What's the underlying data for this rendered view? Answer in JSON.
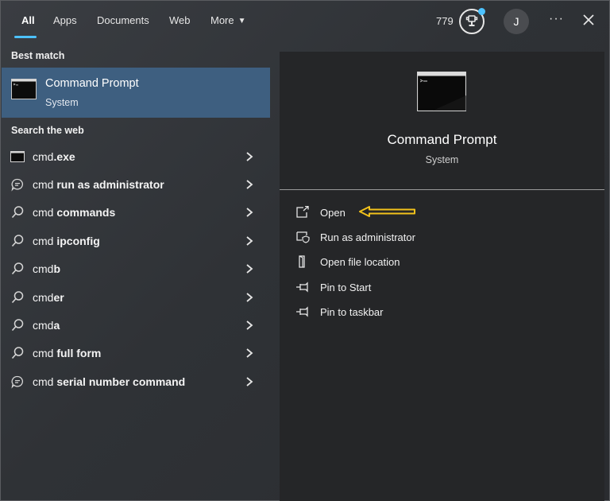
{
  "tabs": [
    {
      "label": "All"
    },
    {
      "label": "Apps"
    },
    {
      "label": "Documents"
    },
    {
      "label": "Web"
    },
    {
      "label": "More"
    }
  ],
  "header": {
    "points": "779",
    "avatar_initial": "J",
    "more_dots": "···"
  },
  "best_match": {
    "section_title": "Best match",
    "title": "Command Prompt",
    "subtitle": "System"
  },
  "web": {
    "section_title": "Search the web",
    "items": [
      {
        "prefix": "cmd",
        "bold": ".exe",
        "icon": "terminal-icon"
      },
      {
        "prefix": "cmd ",
        "bold": "run as administrator",
        "icon": "chat-search-icon"
      },
      {
        "prefix": "cmd ",
        "bold": "commands",
        "icon": "search-icon"
      },
      {
        "prefix": "cmd ",
        "bold": "ipconfig",
        "icon": "search-icon"
      },
      {
        "prefix": "cmd",
        "bold": "b",
        "icon": "search-icon"
      },
      {
        "prefix": "cmd",
        "bold": "er",
        "icon": "search-icon"
      },
      {
        "prefix": "cmd",
        "bold": "a",
        "icon": "search-icon"
      },
      {
        "prefix": "cmd ",
        "bold": "full form",
        "icon": "search-icon"
      },
      {
        "prefix": "cmd ",
        "bold": "serial number command",
        "icon": "chat-search-icon"
      }
    ]
  },
  "preview": {
    "title": "Command Prompt",
    "subtitle": "System",
    "actions": [
      {
        "label": "Open",
        "icon": "open-window-icon"
      },
      {
        "label": "Run as administrator",
        "icon": "shield-window-icon"
      },
      {
        "label": "Open file location",
        "icon": "folder-icon"
      },
      {
        "label": "Pin to Start",
        "icon": "pin-icon"
      },
      {
        "label": "Pin to taskbar",
        "icon": "pin-icon"
      }
    ]
  },
  "colors": {
    "accent": "#4cc2ff",
    "selection": "#3e5f80",
    "annotation": "#f2c21b"
  }
}
